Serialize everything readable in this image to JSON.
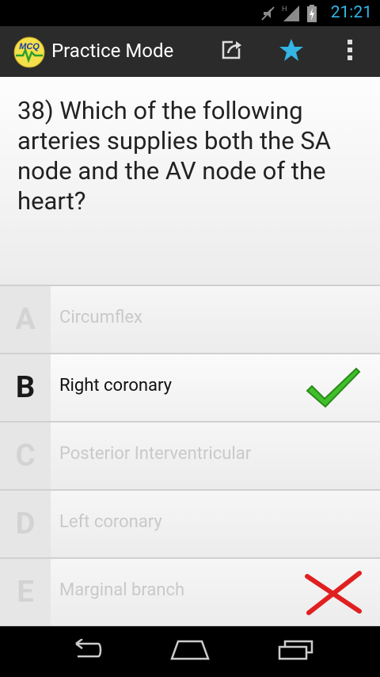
{
  "status_bar": {
    "time": "21:21",
    "network": "H"
  },
  "action_bar": {
    "title": "Practice Mode",
    "logo_text": "MCQ"
  },
  "question": {
    "text": "38) Which of the following arteries supplies both the SA node and the AV node of the heart?"
  },
  "answers": [
    {
      "letter": "A",
      "text": "Circumflex",
      "state": "normal"
    },
    {
      "letter": "B",
      "text": "Right coronary",
      "state": "correct"
    },
    {
      "letter": "C",
      "text": "Posterior Interventricular",
      "state": "normal"
    },
    {
      "letter": "D",
      "text": "Left coronary",
      "state": "normal"
    },
    {
      "letter": "E",
      "text": "Marginal branch",
      "state": "wrong"
    }
  ],
  "colors": {
    "accent": "#33b5e5",
    "correct": "#3fbf2a",
    "wrong": "#e02020"
  },
  "icons": [
    "share-icon",
    "star-icon",
    "overflow-menu-icon",
    "back-icon",
    "home-icon",
    "recent-apps-icon"
  ]
}
